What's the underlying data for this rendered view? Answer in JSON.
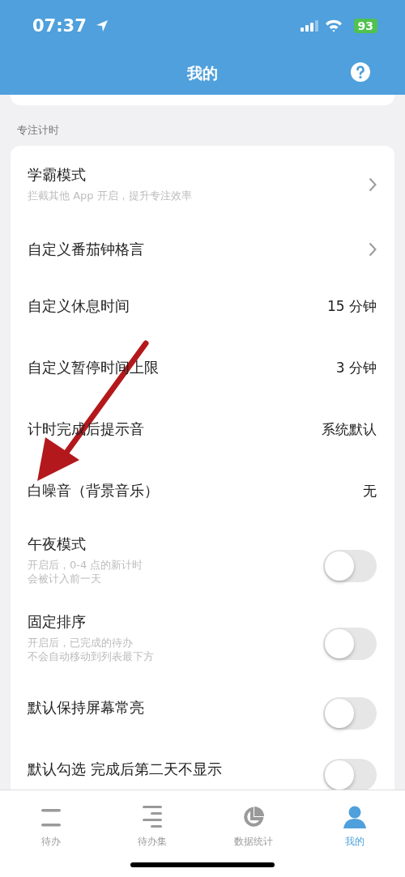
{
  "status_bar": {
    "time": "07:37",
    "battery": "93"
  },
  "header": {
    "title": "我的"
  },
  "section": {
    "label": "专注计时"
  },
  "rows": [
    {
      "kind": "link",
      "title": "学霸模式",
      "subtitle": "拦截其他 App 开启，提升专注效率"
    },
    {
      "kind": "link",
      "title": "自定义番茄钟格言"
    },
    {
      "kind": "value",
      "title": "自定义休息时间",
      "value": "15 分钟"
    },
    {
      "kind": "value",
      "title": "自定义暂停时间上限",
      "value": "3 分钟"
    },
    {
      "kind": "value",
      "title": "计时完成后提示音",
      "value": "系统默认"
    },
    {
      "kind": "value",
      "title": "白噪音（背景音乐）",
      "value": "无"
    },
    {
      "kind": "toggle",
      "title": "午夜模式",
      "subtitle_lines": [
        "开启后，0-4 点的新计时",
        "会被计入前一天"
      ],
      "on": false
    },
    {
      "kind": "toggle",
      "title": "固定排序",
      "subtitle_lines": [
        "开启后，已完成的待办",
        "不会自动移动到列表最下方"
      ],
      "on": false
    },
    {
      "kind": "toggle",
      "title": "默认保持屏幕常亮",
      "on": false
    },
    {
      "kind": "toggle",
      "title": "默认勾选 完成后第二天不显示",
      "on": false
    }
  ],
  "tabs": [
    {
      "label": "待办",
      "selected": false
    },
    {
      "label": "待办集",
      "selected": false
    },
    {
      "label": "数据统计",
      "selected": false
    },
    {
      "label": "我的",
      "selected": true
    }
  ]
}
